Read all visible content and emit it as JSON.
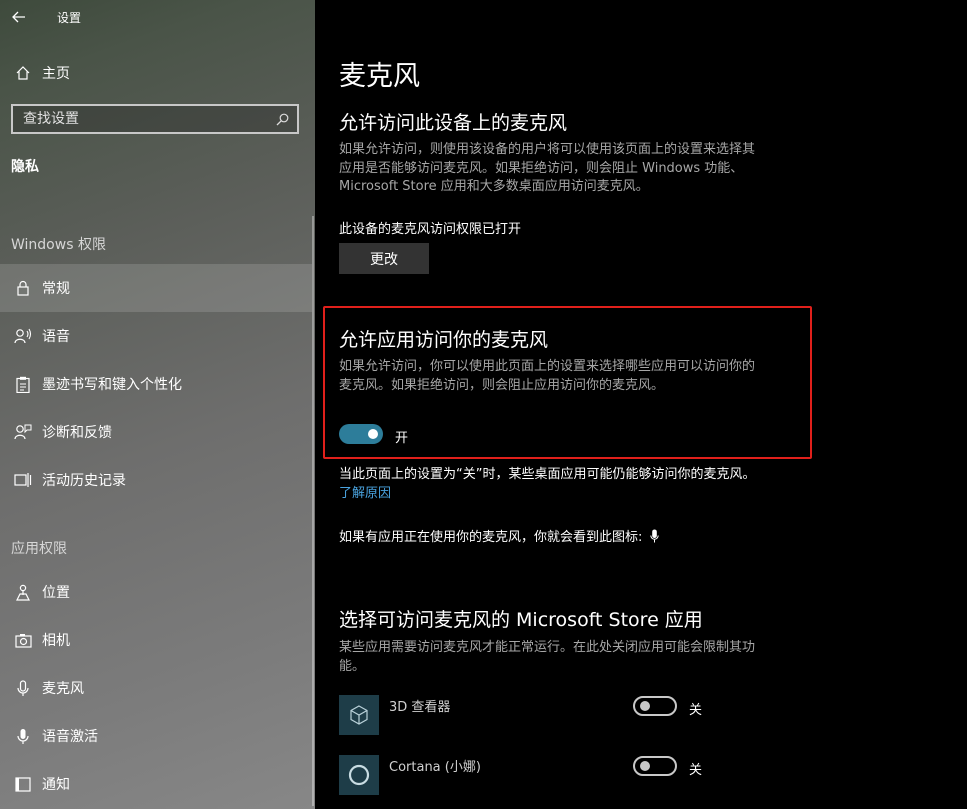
{
  "window": {
    "title": "设置"
  },
  "sidebar": {
    "home": "主页",
    "search_placeholder": "查找设置",
    "section": "隐私",
    "group_windows": "Windows 权限",
    "windows_items": [
      {
        "label": "常规",
        "icon": "lock-icon"
      },
      {
        "label": "语音",
        "icon": "speech-icon"
      },
      {
        "label": "墨迹书写和键入个性化",
        "icon": "clipboard-icon"
      },
      {
        "label": "诊断和反馈",
        "icon": "feedback-icon"
      },
      {
        "label": "活动历史记录",
        "icon": "timeline-icon"
      }
    ],
    "group_apps": "应用权限",
    "app_items": [
      {
        "label": "位置",
        "icon": "location-icon"
      },
      {
        "label": "相机",
        "icon": "camera-icon"
      },
      {
        "label": "麦克风",
        "icon": "microphone-icon"
      },
      {
        "label": "语音激活",
        "icon": "voice-activation-icon"
      },
      {
        "label": "通知",
        "icon": "notification-icon"
      }
    ]
  },
  "main": {
    "title": "麦克风",
    "device_section": {
      "heading": "允许访问此设备上的麦克风",
      "desc_line1": "如果允许访问，则使用该设备的用户将可以使用该页面上的设置来选择其",
      "desc_line2": "应用是否能够访问麦克风。如果拒绝访问，则会阻止 Windows 功能、",
      "desc_line3": "Microsoft Store 应用和大多数桌面应用访问麦克风。",
      "status": "此设备的麦克风访问权限已打开",
      "change_button": "更改"
    },
    "apps_section": {
      "heading": "允许应用访问你的麦克风",
      "desc_line1": "如果允许访问，你可以使用此页面上的设置来选择哪些应用可以访问你的",
      "desc_line2": "麦克风。如果拒绝访问，则会阻止应用访问你的麦克风。",
      "toggle_label": "开"
    },
    "note": "当此页面上的设置为“关”时，某些桌面应用可能仍能够访问你的麦克风。",
    "learn_more": "了解原因",
    "icon_note": "如果有应用正在使用你的麦克风，你就会看到此图标:",
    "store_section": {
      "heading": "选择可访问麦克风的 Microsoft Store 应用",
      "desc_line1": "某些应用需要访问麦克风才能正常运行。在此处关闭应用可能会限制其功",
      "desc_line2": "能。",
      "apps": [
        {
          "name": "3D 查看器",
          "state": "关",
          "icon": "cube-icon"
        },
        {
          "name": "Cortana (小娜)",
          "state": "关",
          "icon": "cortana-icon"
        }
      ]
    }
  },
  "colors": {
    "accent": "#2d7d9a",
    "highlight_border": "#e0201b",
    "link": "#4aa3df"
  }
}
